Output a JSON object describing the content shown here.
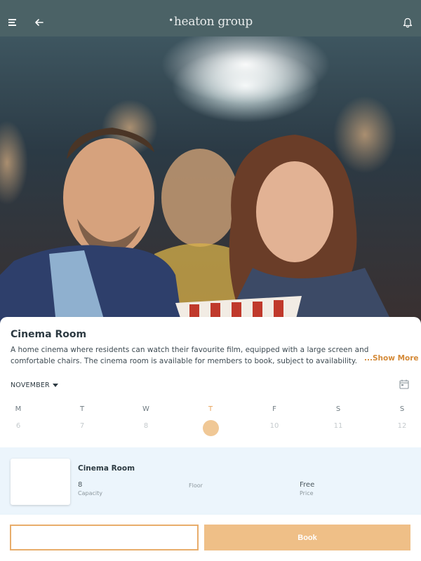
{
  "header": {
    "brand": "heaton group",
    "icons": [
      "menu-icon",
      "back-arrow-icon",
      "bell-icon"
    ]
  },
  "room": {
    "title": "Cinema Room",
    "description": "A home cinema where residents can watch their favourite film, equipped with a large screen and comfortable chairs. The cinema room is available for members to book, subject to availability.",
    "show_more": "...Show More"
  },
  "calendar": {
    "month": "NOVEMBER",
    "days": [
      "M",
      "T",
      "W",
      "T",
      "F",
      "S",
      "S"
    ],
    "dates": [
      "6",
      "7",
      "8",
      "9",
      "10",
      "11",
      "12"
    ],
    "selected_index": 3
  },
  "listing": {
    "title": "Cinema Room",
    "capacity_value": "8",
    "capacity_label": "Capacity",
    "floor_label": "Floor",
    "price_value": "Free",
    "price_label": "Price"
  },
  "actions": {
    "secondary_label": "",
    "book_label": "Book"
  },
  "colors": {
    "header_bg": "#4b6266",
    "accent": "#e8ad6b",
    "book_bg": "#efbf87"
  }
}
